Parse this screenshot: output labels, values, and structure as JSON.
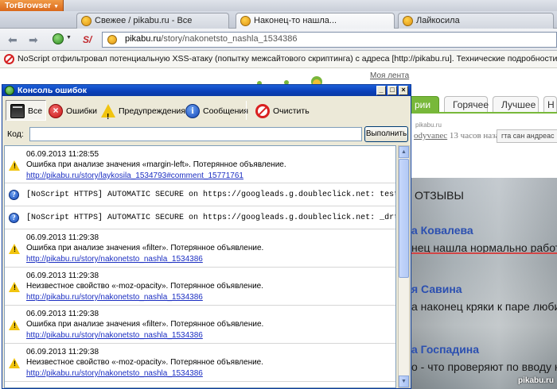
{
  "browser": {
    "menu_button": "TorBrowser",
    "tabs": [
      {
        "label": "Свежее / pikabu.ru - Все",
        "active": false
      },
      {
        "label": "Наконец-то нашла...",
        "active": true
      },
      {
        "label": "Лайкосила",
        "active": false
      }
    ],
    "url": {
      "host": "pikabu.ru",
      "path": "/story/nakonetsto_nashla_1534386"
    },
    "notification": "NoScript отфильтровал потенциальную XSS-атаку (попытку межсайтового скриптинга) с адреса [http://pikabu.ru]. Технические подробности занесены в консоль."
  },
  "site": {
    "my_feed_link": "Моя лента",
    "tabs": [
      "рии",
      "Горячее",
      "Лучшее",
      "Н"
    ],
    "domain_small": "pikabu.ru",
    "meta": {
      "author": "odyvanec",
      "time": "13 часов назад"
    },
    "tag_chip": "гта сан андреас",
    "photo_lines": [
      "ОТЗЫВЫ",
      "а Ковалева",
      "нец нашла нормально работ",
      "я Савина",
      "а наконец кряки к паре люби",
      "а Госпадина",
      "о - что проверяют по вводу н"
    ],
    "watermark": "pikabu.ru"
  },
  "console": {
    "title": "Консоль ошибок",
    "toolbar": {
      "all": "Все",
      "errors": "Ошибки",
      "warnings": "Предупреждения",
      "messages": "Сообщения",
      "clear": "Очистить"
    },
    "code_label": "Код:",
    "code_value": "",
    "evaluate_button": "Выполнить",
    "messages": [
      {
        "type": "warning",
        "time": "06.09.2013 11:28:55",
        "text": "Ошибка при анализе значения «margin-left».  Потерянное объявление.",
        "link": "http://pikabu.ru/story/laykosila_1534793#comment_15771761"
      },
      {
        "type": "info",
        "text": "[NoScript HTTPS] AUTOMATIC SECURE on https://googleads.g.doubleclick.net: test_cooki"
      },
      {
        "type": "info",
        "text": "[NoScript HTTPS] AUTOMATIC SECURE on https://googleads.g.doubleclick.net: _drt_=NO_D"
      },
      {
        "type": "warning",
        "time": "06.09.2013 11:29:38",
        "text": "Ошибка при анализе значения «filter».  Потерянное объявление.",
        "link": "http://pikabu.ru/story/nakonetsto_nashla_1534386"
      },
      {
        "type": "warning",
        "time": "06.09.2013 11:29:38",
        "text": "Неизвестное свойство «-moz-opacity».  Потерянное объявление.",
        "link": "http://pikabu.ru/story/nakonetsto_nashla_1534386"
      },
      {
        "type": "warning",
        "time": "06.09.2013 11:29:38",
        "text": "Ошибка при анализе значения «filter».  Потерянное объявление.",
        "link": "http://pikabu.ru/story/nakonetsto_nashla_1534386"
      },
      {
        "type": "warning",
        "time": "06.09.2013 11:29:38",
        "text": "Неизвестное свойство «-moz-opacity».  Потерянное объявление.",
        "link": "http://pikabu.ru/story/nakonetsto_nashla_1534386"
      }
    ]
  }
}
